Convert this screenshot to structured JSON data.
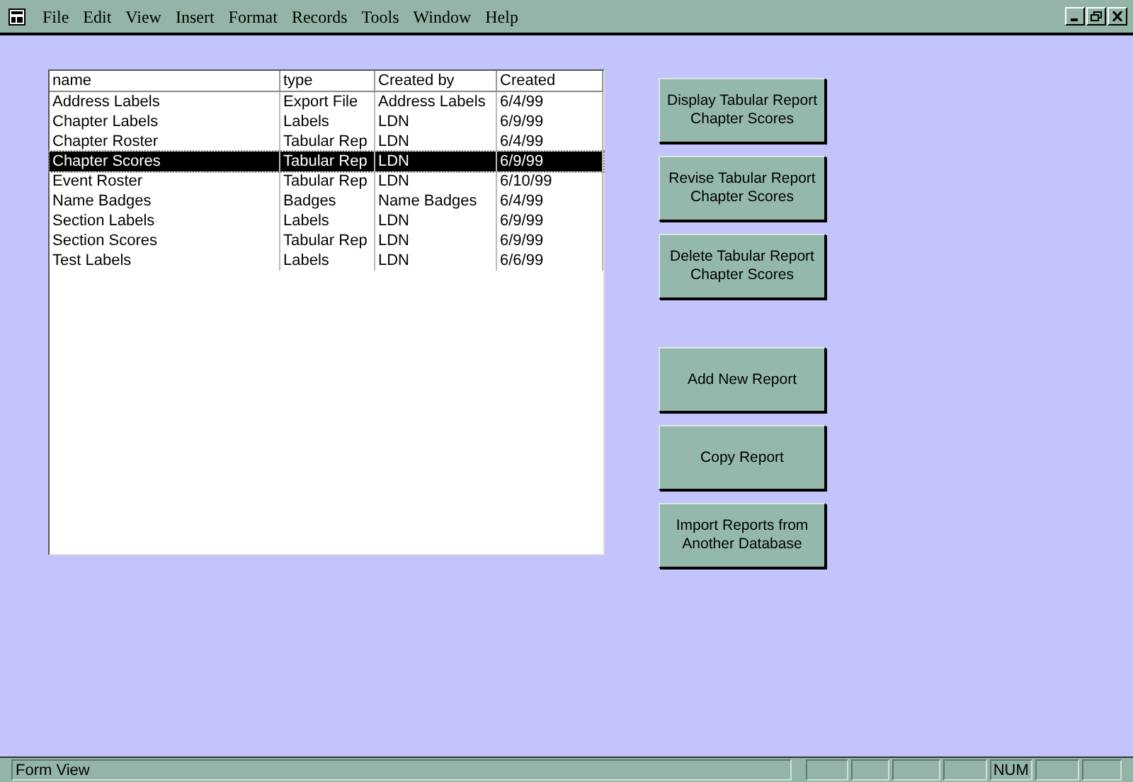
{
  "menu_bar": [
    "File",
    "Edit",
    "View",
    "Insert",
    "Format",
    "Records",
    "Tools",
    "Window",
    "Help"
  ],
  "report_list": {
    "columns": [
      "name",
      "type",
      "Created by",
      "Created"
    ],
    "rows": [
      {
        "cells": [
          "Address Labels",
          "Export File",
          "Address Labels",
          "6/4/99"
        ],
        "selected": false
      },
      {
        "cells": [
          "Chapter Labels",
          "Labels",
          "LDN",
          "6/9/99"
        ],
        "selected": false
      },
      {
        "cells": [
          "Chapter Roster",
          "Tabular Rep",
          "LDN",
          "6/4/99"
        ],
        "selected": false
      },
      {
        "cells": [
          "Chapter Scores",
          "Tabular Rep",
          "LDN",
          "6/9/99"
        ],
        "selected": true
      },
      {
        "cells": [
          "Event Roster",
          "Tabular Rep",
          "LDN",
          "6/10/99"
        ],
        "selected": false
      },
      {
        "cells": [
          "Name Badges",
          "Badges",
          "Name Badges",
          "6/4/99"
        ],
        "selected": false
      },
      {
        "cells": [
          "Section Labels",
          "Labels",
          "LDN",
          "6/9/99"
        ],
        "selected": false
      },
      {
        "cells": [
          "Section Scores",
          "Tabular Rep",
          "LDN",
          "6/9/99"
        ],
        "selected": false
      },
      {
        "cells": [
          "Test Labels",
          "Labels",
          "LDN",
          "6/6/99"
        ],
        "selected": false
      }
    ]
  },
  "selected_report_buttons": [
    "Display Tabular Report Chapter Scores",
    "Revise Tabular Report Chapter Scores",
    "Delete Tabular Report Chapter Scores"
  ],
  "general_buttons": [
    "Add New Report",
    "Copy Report",
    "Import Reports from Another Database"
  ],
  "status_bar": {
    "text": "Form View",
    "indicator": "NUM"
  }
}
